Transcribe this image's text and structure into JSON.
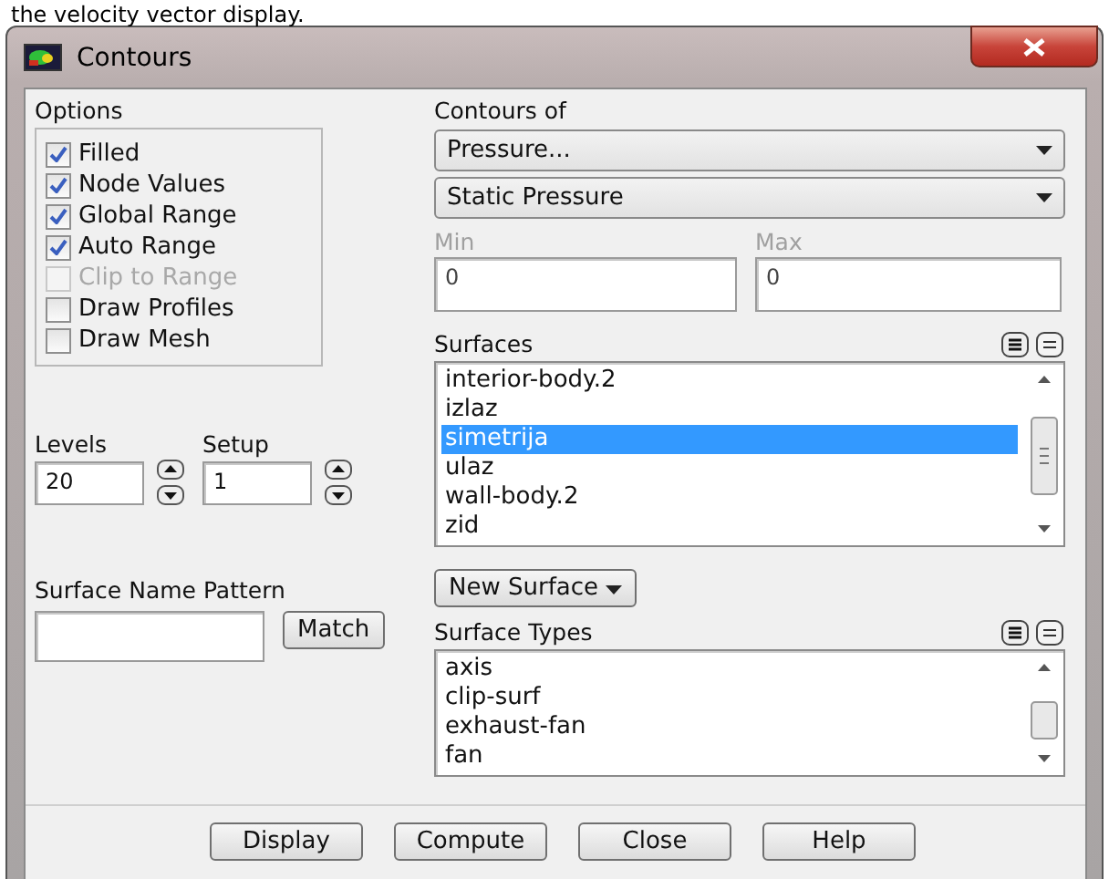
{
  "document_text": "the velocity vector display.",
  "window": {
    "title": "Contours"
  },
  "options": {
    "label": "Options",
    "items": [
      {
        "label": "Filled",
        "checked": true,
        "disabled": false
      },
      {
        "label": "Node Values",
        "checked": true,
        "disabled": false
      },
      {
        "label": "Global Range",
        "checked": true,
        "disabled": false
      },
      {
        "label": "Auto Range",
        "checked": true,
        "disabled": false
      },
      {
        "label": "Clip to Range",
        "checked": false,
        "disabled": true
      },
      {
        "label": "Draw Profiles",
        "checked": false,
        "disabled": false
      },
      {
        "label": "Draw Mesh",
        "checked": false,
        "disabled": false
      }
    ]
  },
  "levels": {
    "label": "Levels",
    "value": "20"
  },
  "setup": {
    "label": "Setup",
    "value": "1"
  },
  "surface_name_pattern": {
    "label": "Surface Name Pattern",
    "button": "Match"
  },
  "contours_of": {
    "label": "Contours of",
    "category": "Pressure...",
    "quantity": "Static Pressure"
  },
  "min": {
    "label": "Min",
    "value": "0",
    "disabled": true
  },
  "max": {
    "label": "Max",
    "value": "0",
    "disabled": true
  },
  "surfaces": {
    "label": "Surfaces",
    "items": [
      {
        "label": "interior-body.2",
        "selected": false
      },
      {
        "label": "izlaz",
        "selected": false
      },
      {
        "label": "simetrija",
        "selected": true
      },
      {
        "label": "ulaz",
        "selected": false
      },
      {
        "label": "wall-body.2",
        "selected": false
      },
      {
        "label": "zid",
        "selected": false
      }
    ]
  },
  "new_surface": "New Surface",
  "surface_types": {
    "label": "Surface Types",
    "items": [
      {
        "label": "axis",
        "selected": false
      },
      {
        "label": "clip-surf",
        "selected": false
      },
      {
        "label": "exhaust-fan",
        "selected": false
      },
      {
        "label": "fan",
        "selected": false
      }
    ]
  },
  "buttons": [
    "Display",
    "Compute",
    "Close",
    "Help"
  ]
}
